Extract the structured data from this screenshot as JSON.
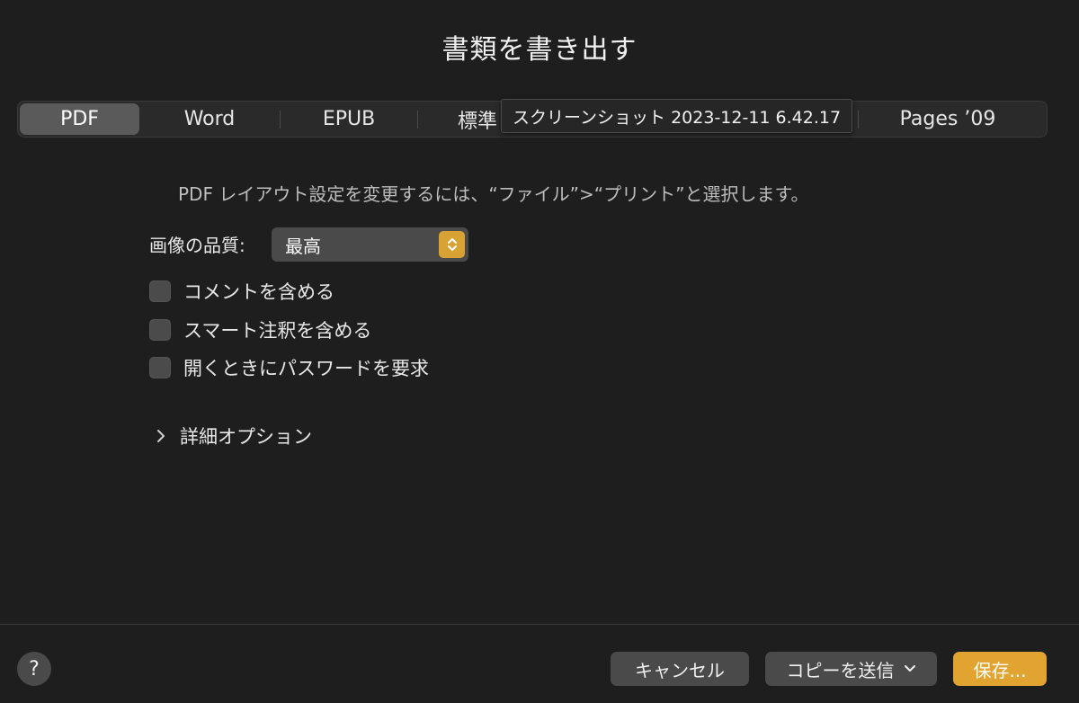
{
  "dialog": {
    "title": "書類を書き出す"
  },
  "tabs": [
    {
      "label": "PDF",
      "selected": true
    },
    {
      "label": "Word",
      "selected": false
    },
    {
      "label": "EPUB",
      "selected": false
    },
    {
      "label": "標準",
      "selected": false
    },
    {
      "label": "",
      "selected": false
    },
    {
      "label": "Pages ’09",
      "selected": false
    }
  ],
  "tooltip": {
    "text": "スクリーンショット 2023-12-11 6.42.17"
  },
  "info_text": "PDF レイアウト設定を変更するには、“ファイル”>“プリント”と選択します。",
  "quality": {
    "label": "画像の品質:",
    "value": "最高"
  },
  "options": [
    {
      "label": "コメントを含める",
      "checked": false
    },
    {
      "label": "スマート注釈を含める",
      "checked": false
    },
    {
      "label": "開くときにパスワードを要求",
      "checked": false
    }
  ],
  "details": {
    "label": "詳細オプション"
  },
  "footer": {
    "help": "?",
    "cancel": "キャンセル",
    "send_copy": "コピーを送信",
    "save": "保存..."
  },
  "colors": {
    "accent": "#e2a430",
    "background": "#1e1e1e",
    "control": "#4a4a4a"
  }
}
